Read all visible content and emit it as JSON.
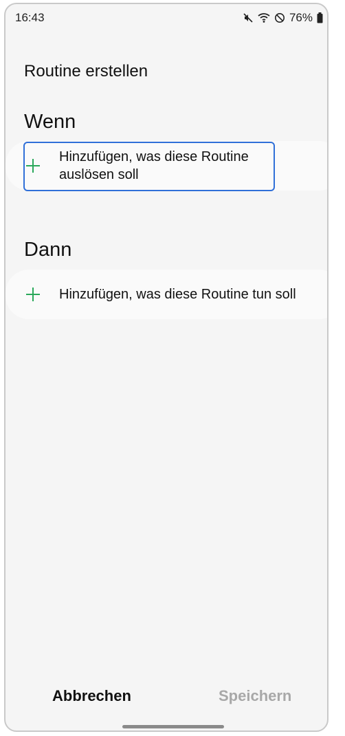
{
  "status_bar": {
    "time": "16:43",
    "battery_percent": "76%",
    "icons": [
      "mute-icon",
      "wifi-icon",
      "do-not-disturb-icon",
      "battery-icon"
    ]
  },
  "page": {
    "title": "Routine erstellen"
  },
  "when_section": {
    "title": "Wenn",
    "add_label": "Hinzufügen, was diese Routine auslösen soll"
  },
  "then_section": {
    "title": "Dann",
    "add_label": "Hinzufügen, was diese Routine tun soll"
  },
  "footer": {
    "cancel_label": "Abbrechen",
    "save_label": "Speichern"
  },
  "colors": {
    "accent_plus": "#2aa85a",
    "focus_border": "#2f6fd8",
    "disabled_text": "#a8a8a8"
  }
}
